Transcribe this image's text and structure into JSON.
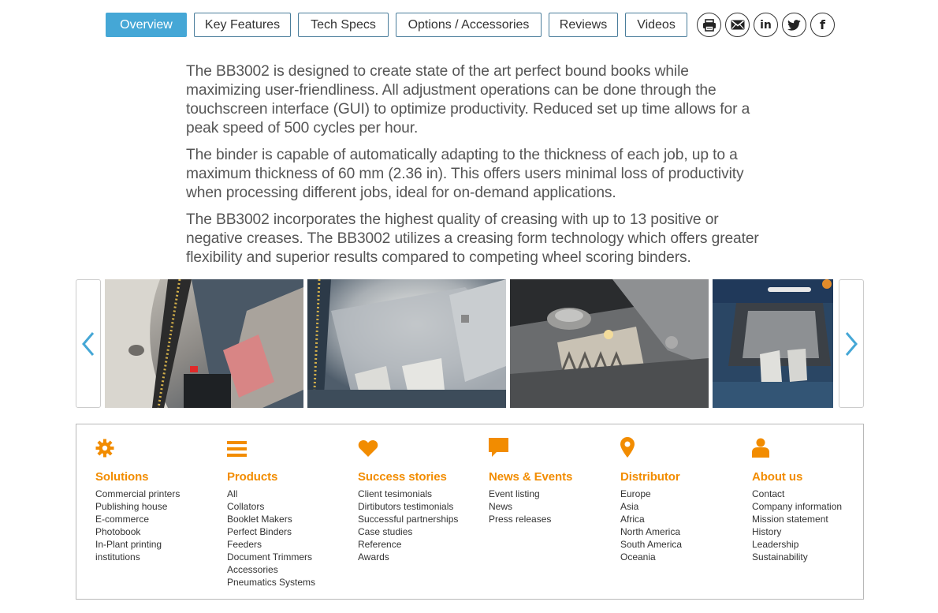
{
  "tabs": [
    {
      "label": "Overview",
      "active": true
    },
    {
      "label": "Key Features"
    },
    {
      "label": "Tech Specs"
    },
    {
      "label": "Options / Accessories"
    },
    {
      "label": "Reviews"
    },
    {
      "label": "Videos"
    }
  ],
  "share": {
    "icons": [
      "print-icon",
      "email-icon",
      "linkedin-icon",
      "twitter-icon",
      "facebook-icon"
    ],
    "linkedin_text": "in",
    "facebook_text": "f"
  },
  "description": [
    "The BB3002 is designed to create state of the art perfect bound books while maximizing user-friendliness. All adjustment operations can be done through the touchscreen interface (GUI) to optimize productivity. Reduced set up time allows for a peak speed of 500 cycles per hour.",
    "The binder is capable of automatically adapting to the thickness of each job, up to a maximum thickness of 60 mm (2.36 in). This offers users minimal loss of productivity when processing different jobs, ideal for on-demand applications.",
    "The BB3002 incorporates the highest quality of creasing with up to 13 positive or negative creases. The BB3002 utilizes a creasing form technology which offers greater flexibility and superior results compared to competing wheel scoring binders."
  ],
  "carousel": {
    "prev_icon": "chevron-left-icon",
    "next_icon": "chevron-right-icon",
    "slide_count": 4
  },
  "footer": {
    "accent_color": "#f28c00",
    "columns": [
      {
        "title": "Solutions",
        "icon": "gear-icon",
        "items": [
          "Commercial printers",
          "Publishing house",
          "E-commerce",
          "Photobook",
          "In-Plant printing",
          "institutions"
        ]
      },
      {
        "title": "Products",
        "icon": "menu-icon",
        "items": [
          "All",
          "Collators",
          "Booklet Makers",
          "Perfect Binders",
          "Feeders",
          "Document Trimmers",
          "Accessories",
          "Pneumatics Systems"
        ]
      },
      {
        "title": "Success stories",
        "icon": "heart-icon",
        "items": [
          "Client tesimonials",
          "Dirtibutors testimonials",
          "Successful partnerships",
          "Case studies",
          "Reference",
          "Awards"
        ]
      },
      {
        "title": "News & Events",
        "icon": "speech-bubble-icon",
        "items": [
          "Event listing",
          "News",
          "Press releases"
        ]
      },
      {
        "title": "Distributor",
        "icon": "map-pin-icon",
        "items": [
          "Europe",
          "Asia",
          "Africa",
          "North America",
          "South America",
          "Oceania"
        ]
      },
      {
        "title": "About us",
        "icon": "person-icon",
        "items": [
          "Contact",
          "Company information",
          "Mission statement",
          "History",
          "Leadership",
          "Sustainability"
        ]
      }
    ]
  }
}
